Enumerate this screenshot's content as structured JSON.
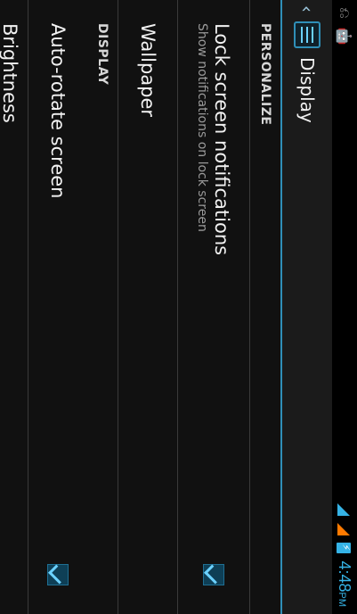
{
  "status": {
    "time": "4:48",
    "ampm": "PM",
    "left_icons": [
      "usb-icon",
      "android-icon"
    ],
    "right_icons": [
      "wifi-signal-icon",
      "cell-signal-icon",
      "battery-charging-icon"
    ]
  },
  "actionbar": {
    "up_glyph": "‹",
    "title": "Display"
  },
  "sections": {
    "personalize": "PERSONALIZE",
    "display": "DISPLAY"
  },
  "items": {
    "lock": {
      "title": "Lock screen notifications",
      "summary": "Show notifications on lock screen",
      "checked": true
    },
    "wallpaper": {
      "title": "Wallpaper"
    },
    "autorotate": {
      "title": "Auto-rotate screen",
      "checked": true
    },
    "brightness": {
      "title": "Brightness"
    }
  },
  "colors": {
    "accent": "#35b3e6",
    "divider": "#3a3a3a",
    "background": "#111111"
  }
}
